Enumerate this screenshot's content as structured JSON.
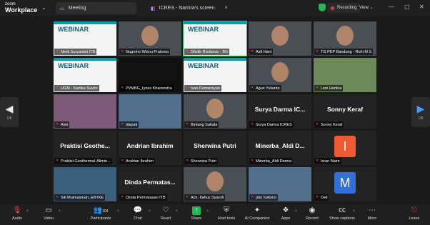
{
  "app": {
    "brand_top": "zoom",
    "brand_bottom": "Workplace"
  },
  "tabs": [
    {
      "label": "Meeting"
    },
    {
      "label": "ICRES - Namira's screen"
    }
  ],
  "status": {
    "recording": "Recording",
    "view": "View"
  },
  "pager": {
    "left": "1/8",
    "right": "1/8"
  },
  "participants": [
    {
      "name": "Ninik Suryantini ITB",
      "kind": "slide",
      "slide": "WEBINAR"
    },
    {
      "name": "Nugroho Wisnu Pratomo",
      "kind": "face"
    },
    {
      "name": "Dikdik Risdianto - BG",
      "kind": "slide",
      "slide": "WEBINAR",
      "active": true
    },
    {
      "name": "Asfi Hani",
      "kind": "face"
    },
    {
      "name": "TG PEP Bandung - Rohi M S",
      "kind": "face"
    },
    {
      "name": "UGM - Kartika Savitri",
      "kind": "slide",
      "slide": "WEBINAR"
    },
    {
      "name": "PVMBG_Iynas Khairendra",
      "kind": "dark"
    },
    {
      "name": "Ivan Pemansyah",
      "kind": "slide",
      "slide": "WEBINAR"
    },
    {
      "name": "Agus Yulianto",
      "kind": "face"
    },
    {
      "name": "Leni Herlina",
      "kind": "photo"
    },
    {
      "name": "Alwi",
      "kind": "photo"
    },
    {
      "name": "Idayati",
      "kind": "photo"
    },
    {
      "name": "Bintang Sahala",
      "kind": "face"
    },
    {
      "name": "Surya Darma ICRES",
      "kind": "name",
      "display": "Surya Darma  IC..."
    },
    {
      "name": "Sonny Keraf",
      "kind": "name",
      "display": "Sonny Keraf"
    },
    {
      "name": "Praktisi Geothermal-Alimin...",
      "kind": "name",
      "display": "Praktisi  Geothe..."
    },
    {
      "name": "Andrian Ibrahim",
      "kind": "name",
      "display": "Andrian Ibrahim"
    },
    {
      "name": "Sherwina Putri",
      "kind": "name",
      "display": "Sherwina Putri"
    },
    {
      "name": "Minerba_Aldi Darma",
      "kind": "name",
      "display": "Minerba_Aldi  D..."
    },
    {
      "name": "Isran Naim",
      "kind": "avatar",
      "letter": "I",
      "color": "#f0582f"
    },
    {
      "name": "Siti Mulmainnah_EBTKE",
      "kind": "photo"
    },
    {
      "name": "Dinda Permatasari ITB",
      "kind": "name",
      "display": "Dinda  Permatas..."
    },
    {
      "name": "Ach. Ifahus Syarofi",
      "kind": "face"
    },
    {
      "name": "prio hutomo",
      "kind": "photo"
    },
    {
      "name": "Deli",
      "kind": "avatar",
      "letter": "M",
      "color": "#2f6fd6"
    }
  ],
  "toolbar": {
    "audio": "Audio",
    "video": "Video",
    "participants": "Participants",
    "participants_count": "104",
    "chat": "Chat",
    "react": "React",
    "share": "Share",
    "host_tools": "Host tools",
    "ai_companion": "AI Companion",
    "apps": "Apps",
    "record": "Record",
    "show_captions": "Show captions",
    "more": "More",
    "leave": "Leave"
  },
  "colors": {
    "accent_green": "#1db954",
    "leave_red": "#e53935",
    "share_green": "#1db954"
  }
}
